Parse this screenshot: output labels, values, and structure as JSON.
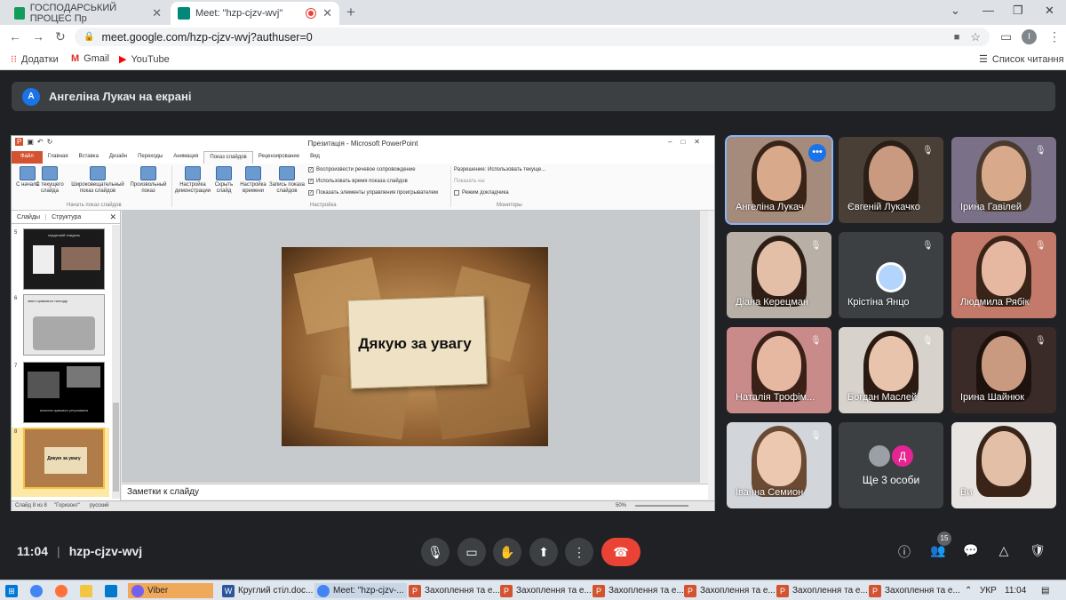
{
  "browser": {
    "tabs": [
      {
        "label": "ГОСПОДАРСЬКИЙ ПРОЦЕС Пр",
        "color": "#0f9d58"
      },
      {
        "label": "Meet: \"hzp-cjzv-wvj\"",
        "color": "#00897b"
      }
    ],
    "url": "meet.google.com/hzp-cjzv-wvj?authuser=0",
    "profile_initial": "I",
    "bookmarks": [
      "Додатки",
      "Gmail",
      "YouTube"
    ],
    "reading_list": "Список читання"
  },
  "meet": {
    "presenter_initial": "A",
    "presenter_text": "Ангеліна Лукач на екрані",
    "time": "11:04",
    "meeting_code": "hzp-cjzv-wvj",
    "people_count": "15",
    "participants": [
      {
        "name": "Ангеліна Лукач"
      },
      {
        "name": "Євгеній Лукачко"
      },
      {
        "name": "Ірина Гавілей"
      },
      {
        "name": "Діана Керецман"
      },
      {
        "name": "Крістіна Янцо"
      },
      {
        "name": "Людмила Рябік"
      },
      {
        "name": "Наталія Трофім..."
      },
      {
        "name": "Богдан Маслей"
      },
      {
        "name": "Ірина Шайнюк"
      },
      {
        "name": "Іванна Семион"
      },
      {
        "name": "Ще 3 особи"
      },
      {
        "name": "Ви"
      }
    ],
    "more_avatar_letter": "Д"
  },
  "ppt": {
    "title": "Презитація - Microsoft PowerPoint",
    "tabs": [
      "Файл",
      "Главная",
      "Вставка",
      "Дизайн",
      "Переходы",
      "Анимация",
      "Показ слайдов",
      "Рецензирование",
      "Вид"
    ],
    "buttons": [
      "С начала",
      "С текущего слайда",
      "Широковещательный показ слайдов",
      "Произвольный показ",
      "Настройка демонстрации",
      "Скрыть слайд",
      "Настройка времени",
      "Запись показа слайдов"
    ],
    "checks": [
      "Воспроизвести речевое сопровождение",
      "Использовать время показа слайдов",
      "Показать элементы управления проигрывателем"
    ],
    "groups": [
      "Начать показ слайдов",
      "Настройка",
      "Мониторы"
    ],
    "monitor_resolution_label": "Разрешение:",
    "monitor_resolution_value": "Использовать текуще...",
    "monitor_show_on": "Показать на:",
    "presenter_mode": "Режим докладчика",
    "panel_tabs": [
      "Слайды",
      "Структура"
    ],
    "slide_numbers": [
      "5",
      "6",
      "7",
      "8"
    ],
    "slide_text": "Дякую за увагу",
    "thumb8_text": "Дякую за увагу",
    "thumb5_text": "сердечний тиждень",
    "thumb6_text": "зміст правового нагляду",
    "thumb7_text": "значення правового регулювання",
    "notes_placeholder": "Заметки к слайду",
    "status_left": "Слайд 8 из 8",
    "status_theme": "\"Горизонт\"",
    "status_lang": "русский",
    "zoom": "50%"
  },
  "taskbar": {
    "items": [
      "Viber",
      "Круглий стіл.doc...",
      "Meet: \"hzp-cjzv-...",
      "Захоплення та е...",
      "Захоплення та е...",
      "Захоплення та е...",
      "Захоплення та е...",
      "Захоплення та е...",
      "Захоплення та е..."
    ],
    "lang": "УКР",
    "clock": "11:04"
  }
}
